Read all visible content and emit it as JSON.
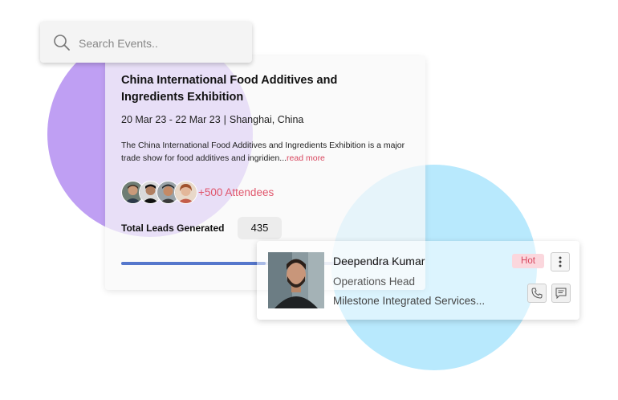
{
  "search": {
    "placeholder": "Search Events.."
  },
  "event": {
    "title": "China International Food Additives and Ingredients Exhibition",
    "dates": "20 Mar 23 - 22 Mar 23",
    "separator": "|",
    "location": "Shanghai, China",
    "description": "The China International Food Additives and Ingredients Exhibition is a major trade show for food additives and ingridien...",
    "read_more": "read more",
    "attendees_label": "+500 Attendees",
    "leads_label": "Total Leads Generated",
    "leads_value": "435",
    "progress": 0.5
  },
  "lead": {
    "name": "Deependra Kumar",
    "role": "Operations Head",
    "company": "Milestone Integrated Services...",
    "badge": "Hot"
  },
  "icons": [
    "search-icon",
    "more-vertical-icon",
    "phone-icon",
    "chat-icon"
  ],
  "colors": {
    "purple_blob": "#bf9ff3",
    "blue_blob": "#b8e9fd",
    "accent_red": "#e0566c",
    "progress": "#5577cc",
    "hot_bg": "#fbd7dd"
  }
}
